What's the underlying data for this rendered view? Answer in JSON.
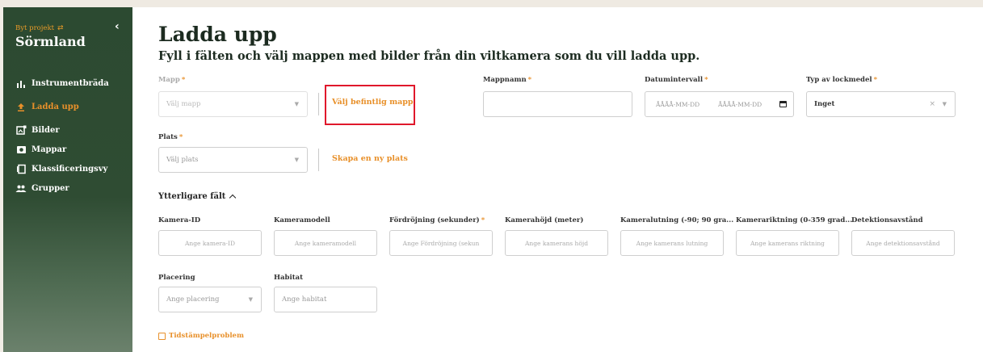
{
  "sidebar": {
    "switch_project": "Byt projekt",
    "project_name": "Sörmland",
    "collapse_icon": "chevron-left-icon",
    "items": [
      {
        "label": "Instrumentbräda",
        "icon": "bar-chart-icon",
        "active": false
      },
      {
        "label": "Ladda upp",
        "icon": "upload-icon",
        "active": true
      },
      {
        "label": "Bilder",
        "icon": "images-icon",
        "active": false
      },
      {
        "label": "Mappar",
        "icon": "camera-folder-icon",
        "active": false
      },
      {
        "label": "Klassificeringsvy",
        "icon": "classification-icon",
        "active": false
      },
      {
        "label": "Grupper",
        "icon": "groups-icon",
        "active": false
      }
    ]
  },
  "page": {
    "title": "Ladda upp",
    "subtitle": "Fyll i fälten och välj mappen med bilder från din viltkamera som du vill ladda upp."
  },
  "form": {
    "mapp": {
      "label": "Mapp",
      "placeholder": "Välj mapp"
    },
    "choose_existing_folder": "Välj befintlig mapp",
    "mappnamn": {
      "label": "Mappnamn",
      "value": ""
    },
    "datumintervall": {
      "label": "Datumintervall",
      "start_placeholder": "ÅÅÅÅ-MM-DD",
      "end_placeholder": "ÅÅÅÅ-MM-DD"
    },
    "typ_av_lockmedel": {
      "label": "Typ av lockmedel",
      "value": "Inget"
    },
    "plats": {
      "label": "Plats",
      "placeholder": "Välj plats"
    },
    "create_place": "Skapa en ny plats",
    "additional_fields_toggle": "Ytterligare fält",
    "extra_fields": [
      {
        "label": "Kamera-ID",
        "placeholder": "Ange kamera-ID",
        "required": false
      },
      {
        "label": "Kameramodell",
        "placeholder": "Ange kameramodell",
        "required": false
      },
      {
        "label": "Fördröjning (sekunder)",
        "placeholder": "Ange Fördröjning (sekun",
        "required": true
      },
      {
        "label": "Kamerahöjd (meter)",
        "placeholder": "Ange kamerans höjd",
        "required": false
      },
      {
        "label": "Kameralutning (-90; 90 gra...",
        "placeholder": "Ange kamerans lutning",
        "required": false
      },
      {
        "label": "Kamerariktning (0-359 grad...",
        "placeholder": "Ange kamerans riktning",
        "required": false
      },
      {
        "label": "Detektionsavstånd",
        "placeholder": "Ange detektionsavstånd",
        "required": false
      }
    ],
    "placering": {
      "label": "Placering",
      "placeholder": "Ange placering"
    },
    "habitat": {
      "label": "Habitat",
      "placeholder": "Ange habitat"
    },
    "timestamp_problem": "Tidstämpelproblem"
  },
  "colors": {
    "sidebar_bg": "#2c4a31",
    "accent": "#e8902a",
    "highlight_box": "#e0182b"
  }
}
